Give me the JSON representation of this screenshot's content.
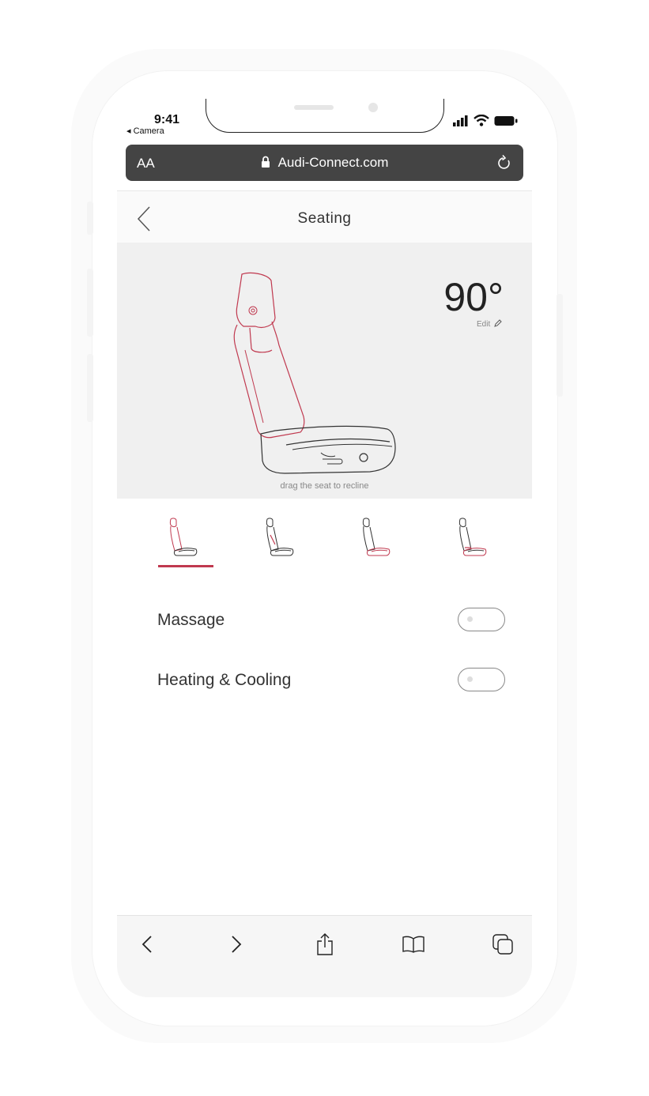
{
  "status_bar": {
    "time": "9:41",
    "back_app": "◂ Camera"
  },
  "browser": {
    "text_size_label": "AA",
    "url": "Audi-Connect.com"
  },
  "header": {
    "title": "Seating"
  },
  "seat": {
    "angle": "90°",
    "edit_label": "Edit",
    "hint": "drag the seat to recline"
  },
  "seat_positions": {
    "icons": [
      "seat-position-1-icon",
      "seat-position-2-icon",
      "seat-position-3-icon",
      "seat-position-4-icon"
    ],
    "selected_index": 0
  },
  "settings": [
    {
      "label": "Massage",
      "enabled": false
    },
    {
      "label": "Heating & Cooling",
      "enabled": false
    }
  ],
  "colors": {
    "accent": "#c0394f",
    "background": "#f0f0f0"
  }
}
